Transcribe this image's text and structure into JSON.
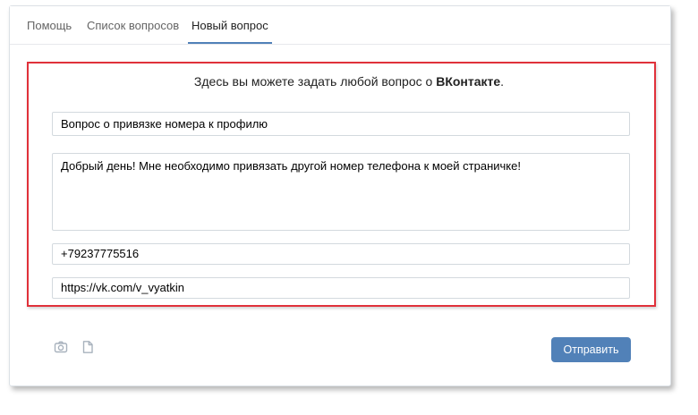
{
  "tabs": [
    {
      "label": "Помощь"
    },
    {
      "label": "Список вопросов"
    },
    {
      "label": "Новый вопрос",
      "active": true
    }
  ],
  "intro": {
    "text_before": "Здесь вы можете задать любой вопрос о ",
    "brand": "ВКонтакте",
    "text_after": "."
  },
  "form": {
    "subject_value": "Вопрос о привязке номера к профилю",
    "body_value": "Добрый день! Мне необходимо привязать другой номер телефона к моей страничке!",
    "phone_value": "+79237775516",
    "link_value": "https://vk.com/v_vyatkin"
  },
  "attachments": [
    {
      "icon": "camera-icon"
    },
    {
      "icon": "document-icon"
    }
  ],
  "actions": {
    "submit_label": "Отправить"
  },
  "colors": {
    "accent": "#5181b8",
    "highlight_border": "#e0313a",
    "field_border": "#d3d9de"
  }
}
